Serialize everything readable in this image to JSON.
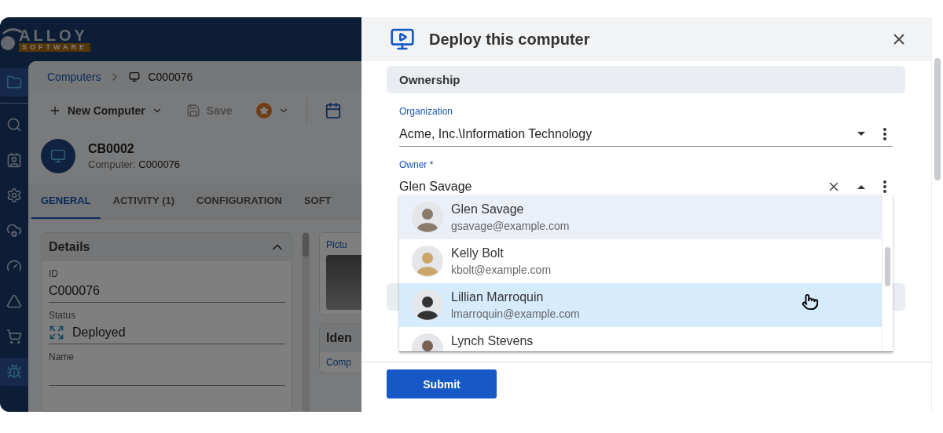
{
  "app": {
    "logo": {
      "word": "ALLOY",
      "tagline": "SOFTWARE"
    },
    "nav": [
      {
        "selected": true
      },
      {
        "selected": false
      },
      {
        "selected": false
      },
      {
        "selected": false
      },
      {
        "selected": false
      },
      {
        "selected": false
      },
      {
        "selected": false
      },
      {
        "selected": false
      },
      {
        "selected": true
      }
    ],
    "breadcrumb": {
      "parent": "Computers",
      "current": "C000076"
    },
    "toolbar": {
      "new": "New Computer",
      "save": "Save"
    },
    "record": {
      "title": "CB0002",
      "subtitle_label": "Computer:",
      "subtitle_value": "C000076"
    },
    "tabs": [
      {
        "label": "GENERAL",
        "selected": true
      },
      {
        "label": "ACTIVITY (1)",
        "selected": false
      },
      {
        "label": "CONFIGURATION",
        "selected": false
      },
      {
        "label": "SOFT",
        "selected": false
      }
    ],
    "details": {
      "title": "Details",
      "fields": [
        {
          "label": "ID",
          "value": "C000076",
          "kind": "text"
        },
        {
          "label": "Status",
          "value": "Deployed",
          "kind": "status"
        },
        {
          "label": "Name",
          "kind": "text"
        }
      ]
    },
    "side_cards": [
      {
        "title": "Pictu",
        "kind": "picture"
      },
      {
        "title": "Iden",
        "field": "Comp",
        "kind": "fields"
      }
    ]
  },
  "drawer": {
    "title": "Deploy this computer",
    "section": "Ownership",
    "fields": [
      {
        "label": "Organization",
        "value": "Acme, Inc.\\Information Technology",
        "focused": false,
        "open": false,
        "clearable": false
      },
      {
        "label": "Owner *",
        "value": "Glen Savage",
        "focused": true,
        "open": true,
        "clearable": true
      }
    ],
    "options": [
      {
        "name": "Glen Savage",
        "email": "gsavage@example.com",
        "selected": true,
        "hovered": false
      },
      {
        "name": "Kelly Bolt",
        "email": "kbolt@example.com",
        "selected": false,
        "hovered": false
      },
      {
        "name": "Lillian Marroquin",
        "email": "lmarroquin@example.com",
        "selected": false,
        "hovered": true
      },
      {
        "name": "Lynch Stevens",
        "selected": false,
        "hovered": false
      }
    ],
    "submit": "Submit"
  }
}
